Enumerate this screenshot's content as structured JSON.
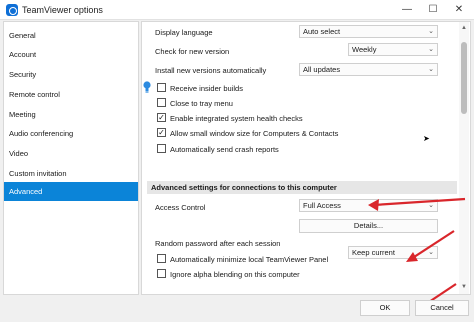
{
  "window": {
    "title": "TeamViewer options",
    "minimize": "—",
    "maximize": "☐",
    "close": "✕"
  },
  "sidebar": {
    "items": [
      {
        "label": "General"
      },
      {
        "label": "Account"
      },
      {
        "label": "Security"
      },
      {
        "label": "Remote control"
      },
      {
        "label": "Meeting"
      },
      {
        "label": "Audio conferencing"
      },
      {
        "label": "Video"
      },
      {
        "label": "Custom invitation"
      },
      {
        "label": "Advanced"
      }
    ],
    "selected": "Advanced"
  },
  "advanced": {
    "display_language_label": "Display language",
    "display_language_value": "Auto select",
    "check_version_label": "Check for new version",
    "check_version_value": "Weekly",
    "install_versions_label": "Install new versions automatically",
    "install_versions_value": "All updates",
    "checkboxes": [
      {
        "label": "Receive insider builds",
        "checked": false
      },
      {
        "label": "Close to tray menu",
        "checked": false
      },
      {
        "label": "Enable integrated system health checks",
        "checked": true
      },
      {
        "label": "Allow small window size for Computers & Contacts",
        "checked": true
      },
      {
        "label": "Automatically send crash reports",
        "checked": false
      }
    ],
    "section_heading": "Advanced settings for connections to this computer",
    "access_control_label": "Access Control",
    "access_control_value": "Full Access",
    "details_button": "Details...",
    "random_password_label": "Random password after each session",
    "random_password_value": "Keep current",
    "minimize_panel_label": "Automatically minimize local TeamViewer Panel",
    "minimize_panel_checked": false,
    "ignore_alpha_label": "Ignore alpha blending on this computer",
    "ignore_alpha_checked": false
  },
  "footer": {
    "ok": "OK",
    "cancel": "Cancel"
  },
  "colors": {
    "accent": "#0b84d8",
    "annotation_arrow": "#d9262b"
  },
  "icons": {
    "chevron": "⌄",
    "check": "✓"
  }
}
